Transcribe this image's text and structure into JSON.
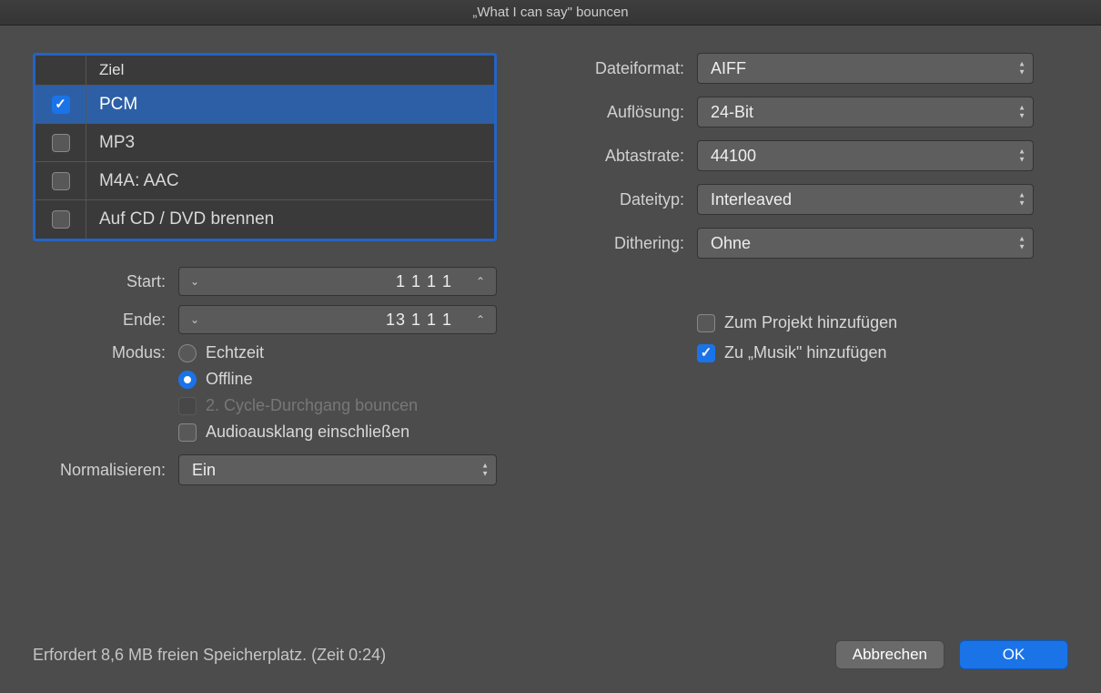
{
  "title": "„What I can say\" bouncen",
  "destination": {
    "header": "Ziel",
    "rows": [
      {
        "label": "PCM",
        "checked": true,
        "selected": true
      },
      {
        "label": "MP3",
        "checked": false,
        "selected": false
      },
      {
        "label": "M4A: AAC",
        "checked": false,
        "selected": false
      },
      {
        "label": "Auf CD / DVD brennen",
        "checked": false,
        "selected": false
      }
    ]
  },
  "range": {
    "start_label": "Start:",
    "start_value": "1  1  1      1",
    "end_label": "Ende:",
    "end_value": "13  1  1      1"
  },
  "mode": {
    "label": "Modus:",
    "realtime": "Echtzeit",
    "offline": "Offline",
    "selected": "offline",
    "second_cycle": "2. Cycle-Durchgang bouncen",
    "second_cycle_enabled": false,
    "tail": "Audioausklang einschließen",
    "tail_checked": false
  },
  "normalize": {
    "label": "Normalisieren:",
    "value": "Ein"
  },
  "format": {
    "file_format_label": "Dateiformat:",
    "file_format_value": "AIFF",
    "resolution_label": "Auflösung:",
    "resolution_value": "24-Bit",
    "sample_rate_label": "Abtastrate:",
    "sample_rate_value": "44100",
    "file_type_label": "Dateityp:",
    "file_type_value": "Interleaved",
    "dithering_label": "Dithering:",
    "dithering_value": "Ohne"
  },
  "add": {
    "project": "Zum Projekt hinzufügen",
    "project_checked": false,
    "music": "Zu „Musik\" hinzufügen",
    "music_checked": true
  },
  "footer": {
    "status": "Erfordert 8,6 MB freien Speicherplatz. (Zeit 0:24)",
    "cancel": "Abbrechen",
    "ok": "OK"
  }
}
